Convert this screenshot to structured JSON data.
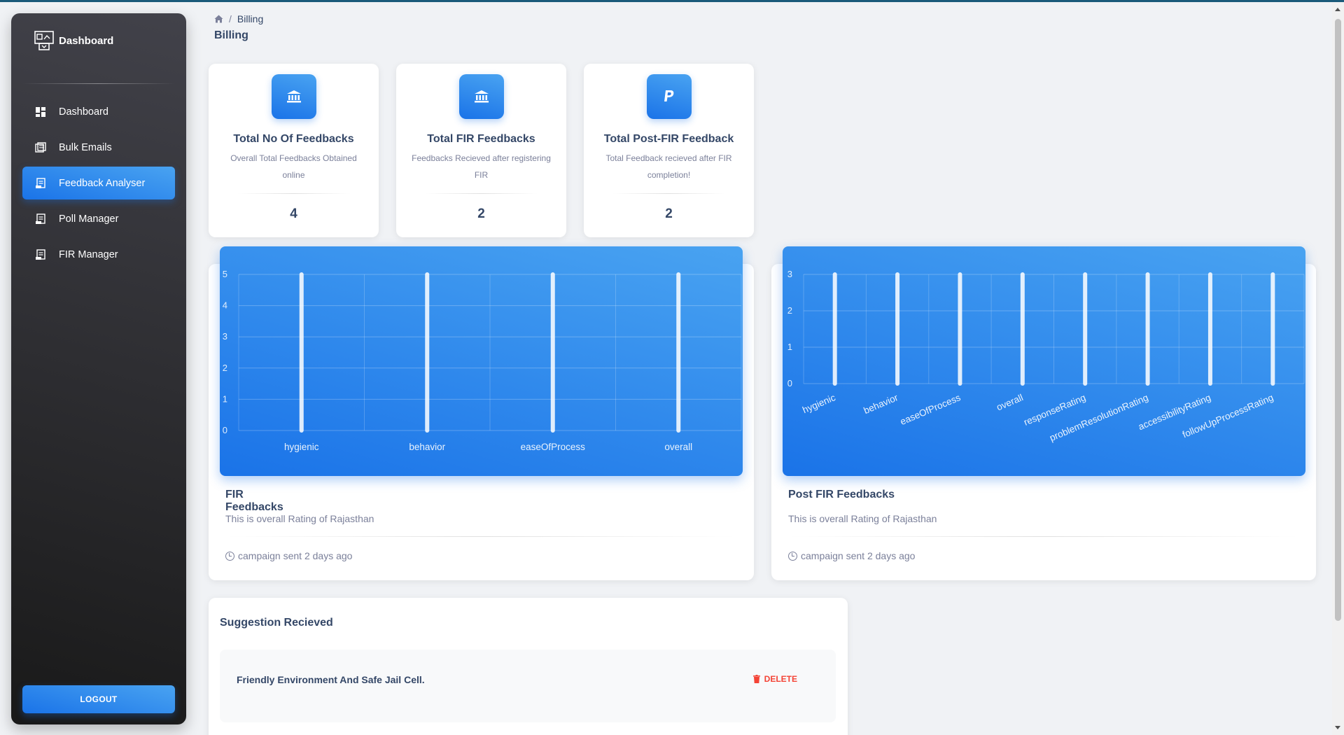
{
  "sidebar": {
    "brand": "Dashboard",
    "items": [
      {
        "label": "Dashboard",
        "icon": "grid-icon",
        "active": false
      },
      {
        "label": "Bulk Emails",
        "icon": "email-icon",
        "active": false
      },
      {
        "label": "Feedback Analyser",
        "icon": "receipt-icon",
        "active": true
      },
      {
        "label": "Poll Manager",
        "icon": "receipt-icon",
        "active": false
      },
      {
        "label": "FIR Manager",
        "icon": "receipt-icon",
        "active": false
      }
    ],
    "logout_label": "LOGOUT"
  },
  "header": {
    "breadcrumb_current": "Billing",
    "title": "Billing"
  },
  "stats": [
    {
      "title": "Total No Of Feedbacks",
      "desc": "Overall Total Feedbacks Obtained online",
      "value": "4",
      "icon": "bank-icon"
    },
    {
      "title": "Total FIR Feedbacks",
      "desc": "Feedbacks Recieved after registering FIR",
      "value": "2",
      "icon": "bank-icon"
    },
    {
      "title": "Total Post-FIR Feedback",
      "desc": "Total Feedback recieved after FIR completion!",
      "value": "2",
      "icon": "paypal-icon"
    }
  ],
  "chart_cards": [
    {
      "title": "FIR Feedbacks",
      "subtitle": "This is overall Rating of Rajasthan",
      "footer": "campaign sent 2 days ago"
    },
    {
      "title": "Post FIR Feedbacks",
      "subtitle": "This is overall Rating of Rajasthan",
      "footer": "campaign sent 2 days ago"
    }
  ],
  "chart_data": [
    {
      "type": "bar",
      "categories": [
        "hygienic",
        "behavior",
        "easeOfProcess",
        "overall"
      ],
      "values": [
        5,
        5,
        5,
        5
      ],
      "ylim": [
        0,
        5
      ],
      "yticks": [
        0,
        1,
        2,
        3,
        4,
        5
      ],
      "grid": true,
      "title": "",
      "xlabel": "",
      "ylabel": ""
    },
    {
      "type": "bar",
      "categories": [
        "hygienic",
        "behavior",
        "easeOfProcess",
        "overall",
        "responseRating",
        "problemResolutionRating",
        "accessibilityRating",
        "followUpProcessRating"
      ],
      "values": [
        3,
        3,
        3,
        3,
        3,
        3,
        3,
        3
      ],
      "ylim": [
        0,
        3
      ],
      "yticks": [
        0,
        1,
        2,
        3
      ],
      "grid": true,
      "title": "",
      "xlabel": "",
      "ylabel": ""
    }
  ],
  "suggestions": {
    "title": "Suggestion Recieved",
    "items": [
      {
        "text": "Friendly Environment And Safe Jail Cell.",
        "action": "DELETE"
      }
    ]
  }
}
